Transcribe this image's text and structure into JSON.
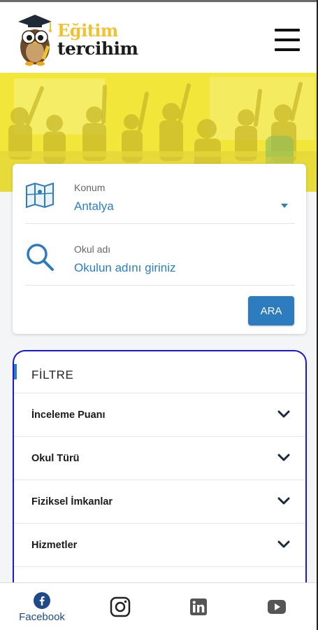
{
  "header": {
    "logo_line1": "Eğitim",
    "logo_line2": "tercihim",
    "menu_icon": "hamburger-menu-icon"
  },
  "search": {
    "location_label": "Konum",
    "location_value": "Antalya",
    "location_icon": "map-icon",
    "school_label": "Okul adı",
    "school_placeholder": "Okulun adını giriniz",
    "school_icon": "search-icon",
    "submit_label": "ARA"
  },
  "filter": {
    "title": "FİLTRE",
    "items": [
      {
        "label": "İnceleme Puanı"
      },
      {
        "label": "Okul Türü"
      },
      {
        "label": "Fiziksel İmkanlar"
      },
      {
        "label": "Hizmetler"
      }
    ]
  },
  "bottom_nav": {
    "facebook_label": "Facebook",
    "items": [
      "facebook-icon",
      "instagram-icon",
      "linkedin-icon",
      "youtube-icon"
    ]
  },
  "colors": {
    "accent": "#2d7cc0",
    "logo_yellow": "#f2c12e",
    "filter_border": "#1a17d6",
    "hero_yellow": "#f3e63a"
  }
}
